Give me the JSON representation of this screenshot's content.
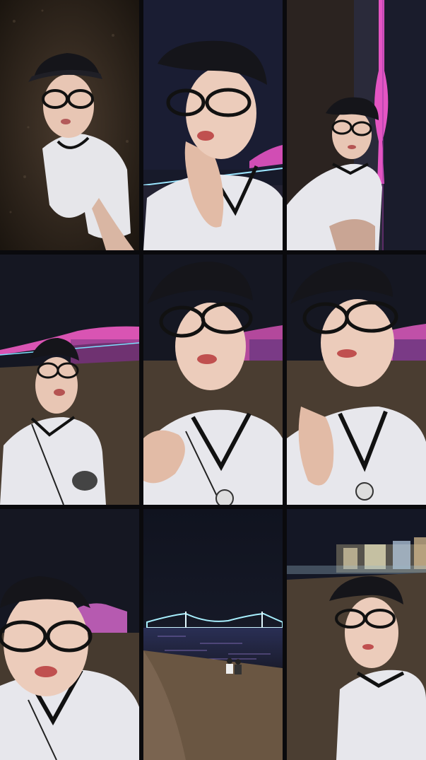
{
  "grid": {
    "rows": 3,
    "cols": 3,
    "frames": [
      {
        "scene": "beach-sand-closeup"
      },
      {
        "scene": "night-sky-bridge-right"
      },
      {
        "scene": "pillar-with-pink-lights"
      },
      {
        "scene": "beach-pink-bridge"
      },
      {
        "scene": "beach-bridge-closeup"
      },
      {
        "scene": "beach-bridge-closeup-hand"
      },
      {
        "scene": "beach-bridge-left"
      },
      {
        "scene": "bridge-and-shore"
      },
      {
        "scene": "blurry-city-lights"
      }
    ]
  },
  "colors": {
    "night_sky": "#151722",
    "sand": "#5a4838",
    "bridge_pink": "#e04fb6",
    "bridge_cyan": "#8fe6ff",
    "shirt": "#e9e9ee",
    "cap": "#15151a",
    "skin": "#e8c6b4"
  }
}
